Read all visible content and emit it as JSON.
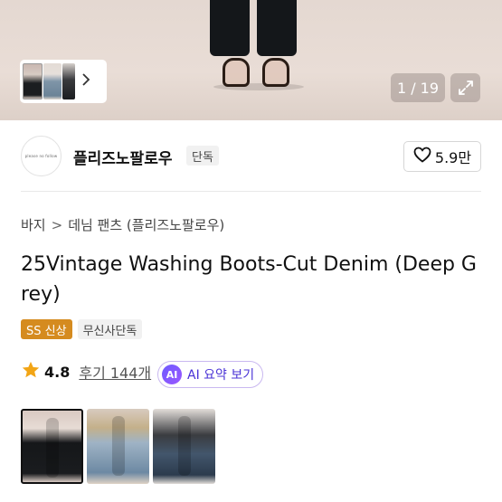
{
  "gallery": {
    "counter": "1 / 19"
  },
  "brand": {
    "name": "플리즈노팔로우",
    "badge": "단독",
    "logo_text": "please no follow",
    "likes": "5.9만"
  },
  "breadcrumb": {
    "items": [
      "바지",
      "데님 팬츠 (플리즈노팔로우)"
    ],
    "separator": ">"
  },
  "product": {
    "title": "25Vintage Washing Boots-Cut Denim (Deep Grey)",
    "tags": [
      "SS 신상",
      "무신사단독"
    ],
    "rating": "4.8",
    "reviews": "후기 144개",
    "ai_summary_label": "AI 요약 보기",
    "ai_icon_text": "AI"
  },
  "colors": {
    "tag_accent": "#d58b1f",
    "star": "#f2a516",
    "ai_accent": "#5b3ff0"
  },
  "icons": {
    "like": "heart-outline-icon",
    "expand": "expand-arrows-icon",
    "chevron": "chevron-right-icon",
    "star": "star-filled-icon"
  }
}
